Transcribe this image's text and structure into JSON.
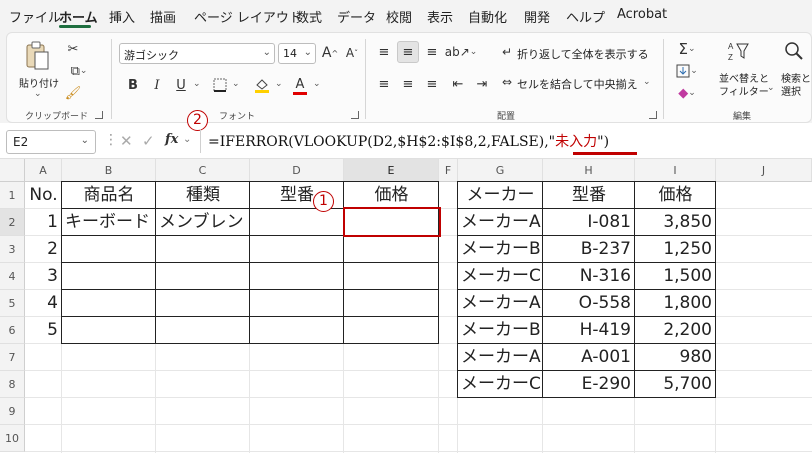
{
  "menu": {
    "tabs": [
      "ファイル",
      "ホーム",
      "挿入",
      "描画",
      "ページ レイアウト",
      "数式",
      "データ",
      "校閲",
      "表示",
      "自動化",
      "開発",
      "ヘルプ",
      "Acrobat"
    ],
    "active": "ホーム"
  },
  "ribbon": {
    "clipboard": {
      "paste_label": "貼り付け",
      "group": "クリップボード"
    },
    "font": {
      "name": "游ゴシック",
      "size": "14",
      "group": "フォント",
      "grow": "A",
      "shrink": "A",
      "bold": "B",
      "italic": "I",
      "underline": "U",
      "color_letter": "A"
    },
    "alignment": {
      "wrap_label": "折り返して全体を表示する",
      "merge_label": "セルを結合して中央揃え",
      "group": "配置"
    },
    "editing": {
      "sort_label_1": "並べ替えと",
      "sort_label_2": "フィルター",
      "find_label_1": "検索と",
      "find_label_2": "選択",
      "group": "編集"
    }
  },
  "formula_bar": {
    "name_box": "E2",
    "fx": "fx",
    "formula_prefix": "=IFERROR(VLOOKUP(D2,$H$2:$I$8,2,FALSE),\"",
    "formula_highlight": "未入力",
    "formula_suffix": "\")"
  },
  "grid": {
    "columns": [
      "A",
      "B",
      "C",
      "D",
      "E",
      "F",
      "G",
      "H",
      "I",
      "J"
    ],
    "rows": [
      "1",
      "2",
      "3",
      "4",
      "5",
      "6",
      "7",
      "8",
      "9",
      "10"
    ],
    "left_table": {
      "headers": [
        "No.",
        "商品名",
        "種類",
        "型番",
        "価格"
      ],
      "rows": [
        [
          "1",
          "キーボード",
          "メンブレン",
          "",
          ""
        ],
        [
          "2",
          "",
          "",
          "",
          ""
        ],
        [
          "3",
          "",
          "",
          "",
          ""
        ],
        [
          "4",
          "",
          "",
          "",
          ""
        ],
        [
          "5",
          "",
          "",
          "",
          ""
        ]
      ]
    },
    "right_table": {
      "headers": [
        "メーカー",
        "型番",
        "価格"
      ],
      "rows": [
        [
          "メーカーA",
          "I-081",
          "3,850"
        ],
        [
          "メーカーB",
          "B-237",
          "1,250"
        ],
        [
          "メーカーC",
          "N-316",
          "1,500"
        ],
        [
          "メーカーA",
          "O-558",
          "1,800"
        ],
        [
          "メーカーB",
          "H-419",
          "2,200"
        ],
        [
          "メーカーA",
          "A-001",
          "980"
        ],
        [
          "メーカーC",
          "E-290",
          "5,700"
        ]
      ]
    }
  },
  "callouts": {
    "one": "1",
    "two": "2"
  },
  "colors": {
    "accent_green": "#1e6e3f",
    "annotation_red": "#c00000"
  }
}
